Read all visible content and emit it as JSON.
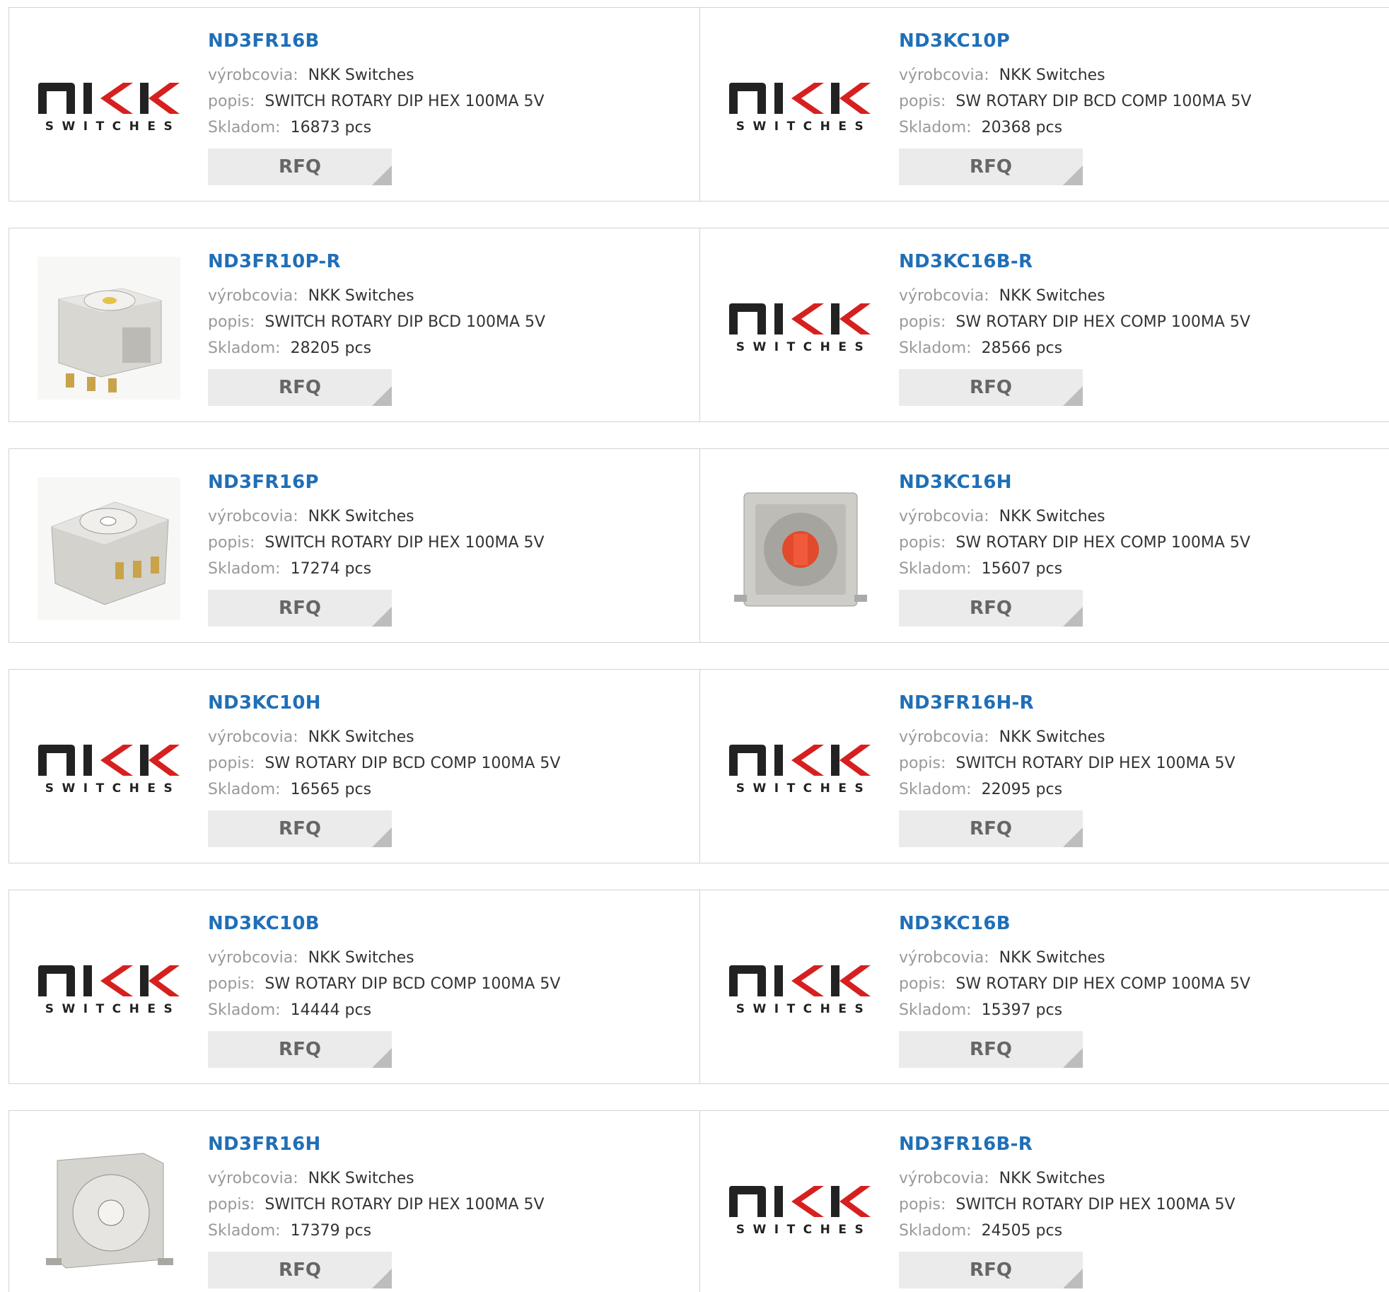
{
  "labels": {
    "manufacturer": "výrobcovia:",
    "description": "popis:",
    "stock": "Skladom:",
    "rfq": "RFQ"
  },
  "colors": {
    "title": "#1f6fb7",
    "label": "#999999",
    "rfq_bg": "#ebebeb",
    "logo_red": "#d6201f"
  },
  "logo_text": {
    "switches": "SWITCHES"
  },
  "products": [
    {
      "name": "ND3FR16B",
      "manufacturer": "NKK Switches",
      "description": "SWITCH ROTARY DIP HEX 100MA 5V",
      "stock": "16873 pcs",
      "image": "nkk-logo"
    },
    {
      "name": "ND3KC10P",
      "manufacturer": "NKK Switches",
      "description": "SW ROTARY DIP BCD COMP 100MA 5V",
      "stock": "20368 pcs",
      "image": "nkk-logo"
    },
    {
      "name": "ND3FR10P-R",
      "manufacturer": "NKK Switches",
      "description": "SWITCH ROTARY DIP BCD 100MA 5V",
      "stock": "28205 pcs",
      "image": "switch-photo-top"
    },
    {
      "name": "ND3KC16B-R",
      "manufacturer": "NKK Switches",
      "description": "SW ROTARY DIP HEX COMP 100MA 5V",
      "stock": "28566 pcs",
      "image": "nkk-logo"
    },
    {
      "name": "ND3FR16P",
      "manufacturer": "NKK Switches",
      "description": "SWITCH ROTARY DIP HEX 100MA 5V",
      "stock": "17274 pcs",
      "image": "switch-photo-angled"
    },
    {
      "name": "ND3KC16H",
      "manufacturer": "NKK Switches",
      "description": "SW ROTARY DIP HEX COMP 100MA 5V",
      "stock": "15607 pcs",
      "image": "switch-photo-red"
    },
    {
      "name": "ND3KC10H",
      "manufacturer": "NKK Switches",
      "description": "SW ROTARY DIP BCD COMP 100MA 5V",
      "stock": "16565 pcs",
      "image": "nkk-logo"
    },
    {
      "name": "ND3FR16H-R",
      "manufacturer": "NKK Switches",
      "description": "SWITCH ROTARY DIP HEX 100MA 5V",
      "stock": "22095 pcs",
      "image": "nkk-logo"
    },
    {
      "name": "ND3KC10B",
      "manufacturer": "NKK Switches",
      "description": "SW ROTARY DIP BCD COMP 100MA 5V",
      "stock": "14444 pcs",
      "image": "nkk-logo"
    },
    {
      "name": "ND3KC16B",
      "manufacturer": "NKK Switches",
      "description": "SW ROTARY DIP HEX COMP 100MA 5V",
      "stock": "15397 pcs",
      "image": "nkk-logo"
    },
    {
      "name": "ND3FR16H",
      "manufacturer": "NKK Switches",
      "description": "SWITCH ROTARY DIP HEX 100MA 5V",
      "stock": "17379 pcs",
      "image": "switch-photo-side"
    },
    {
      "name": "ND3FR16B-R",
      "manufacturer": "NKK Switches",
      "description": "SWITCH ROTARY DIP HEX 100MA 5V",
      "stock": "24505 pcs",
      "image": "nkk-logo"
    }
  ]
}
